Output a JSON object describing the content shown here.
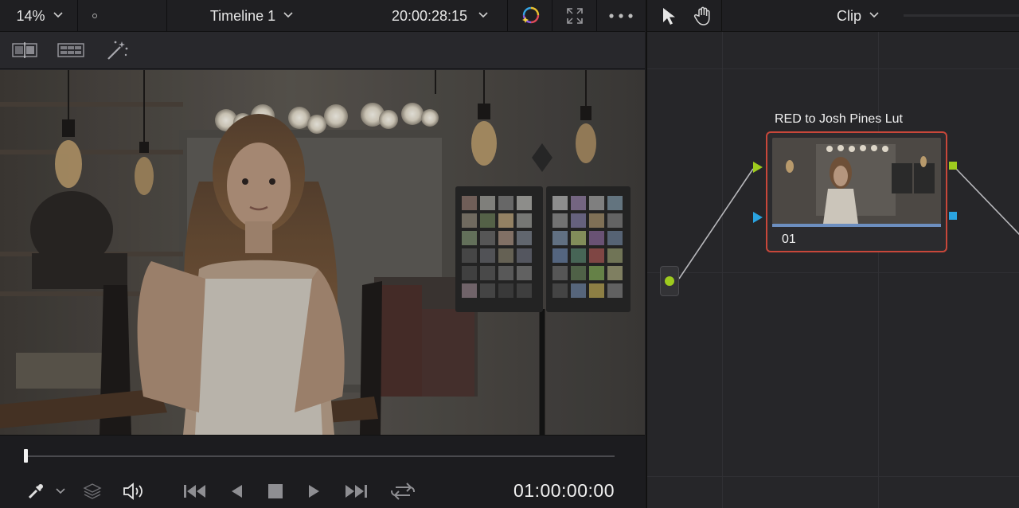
{
  "viewer": {
    "zoom": "14%",
    "timeline_name": "Timeline 1",
    "source_timecode": "20:00:28:15",
    "playhead_timecode": "01:00:00:00",
    "scrub_position": 0.0
  },
  "viewer_icons": {
    "zoom_dropdown": "chevron-down-icon",
    "timeline_dropdown": "chevron-down-icon",
    "timecode_dropdown": "chevron-down-icon",
    "color_fx": "color-wheel-sparkle-icon",
    "fullscreen": "expand-icon",
    "more": "ellipsis-icon",
    "split_wipe": "split-wipe-icon",
    "gallery": "grid-view-icon",
    "magic": "magic-wand-icon"
  },
  "transport": {
    "picker": "eyedropper-icon",
    "layers": "layers-icon",
    "audio": "speaker-icon",
    "first": "skip-back-icon",
    "reverse": "play-reverse-icon",
    "stop": "stop-icon",
    "play": "play-icon",
    "last": "skip-forward-icon",
    "loop": "loop-icon"
  },
  "node_editor": {
    "mode": "Clip",
    "node": {
      "label": "RED to  Josh Pines Lut",
      "number": "01"
    }
  },
  "colors": {
    "accent_node_border": "#c8473a",
    "input_green": "#9ecb1e",
    "input_blue": "#2aa3e0",
    "node_bar": "#6d8fc0"
  }
}
